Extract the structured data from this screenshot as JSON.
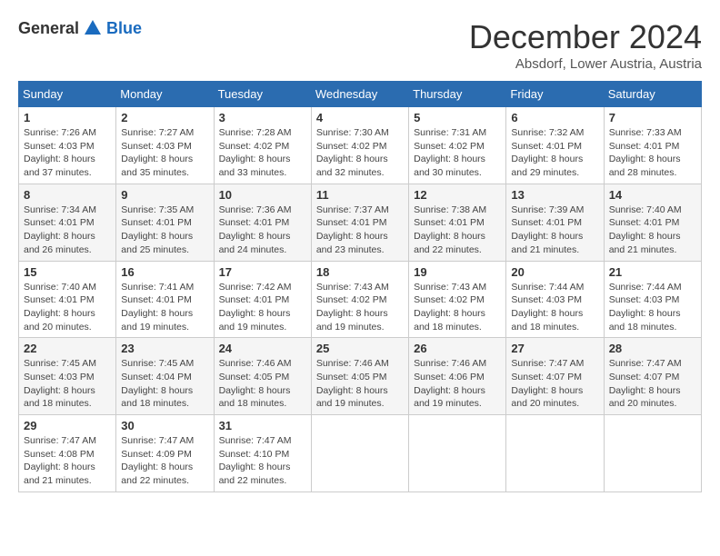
{
  "header": {
    "logo_general": "General",
    "logo_blue": "Blue",
    "title": "December 2024",
    "location": "Absdorf, Lower Austria, Austria"
  },
  "calendar": {
    "days_of_week": [
      "Sunday",
      "Monday",
      "Tuesday",
      "Wednesday",
      "Thursday",
      "Friday",
      "Saturday"
    ],
    "weeks": [
      [
        null,
        {
          "day": 2,
          "sunrise": "7:27 AM",
          "sunset": "4:03 PM",
          "daylight": "8 hours and 35 minutes."
        },
        {
          "day": 3,
          "sunrise": "7:28 AM",
          "sunset": "4:02 PM",
          "daylight": "8 hours and 33 minutes."
        },
        {
          "day": 4,
          "sunrise": "7:30 AM",
          "sunset": "4:02 PM",
          "daylight": "8 hours and 32 minutes."
        },
        {
          "day": 5,
          "sunrise": "7:31 AM",
          "sunset": "4:02 PM",
          "daylight": "8 hours and 30 minutes."
        },
        {
          "day": 6,
          "sunrise": "7:32 AM",
          "sunset": "4:01 PM",
          "daylight": "8 hours and 29 minutes."
        },
        {
          "day": 7,
          "sunrise": "7:33 AM",
          "sunset": "4:01 PM",
          "daylight": "8 hours and 28 minutes."
        }
      ],
      [
        {
          "day": 1,
          "sunrise": "7:26 AM",
          "sunset": "4:03 PM",
          "daylight": "8 hours and 37 minutes."
        },
        null,
        null,
        null,
        null,
        null,
        null
      ],
      [
        {
          "day": 8,
          "sunrise": "7:34 AM",
          "sunset": "4:01 PM",
          "daylight": "8 hours and 26 minutes."
        },
        {
          "day": 9,
          "sunrise": "7:35 AM",
          "sunset": "4:01 PM",
          "daylight": "8 hours and 25 minutes."
        },
        {
          "day": 10,
          "sunrise": "7:36 AM",
          "sunset": "4:01 PM",
          "daylight": "8 hours and 24 minutes."
        },
        {
          "day": 11,
          "sunrise": "7:37 AM",
          "sunset": "4:01 PM",
          "daylight": "8 hours and 23 minutes."
        },
        {
          "day": 12,
          "sunrise": "7:38 AM",
          "sunset": "4:01 PM",
          "daylight": "8 hours and 22 minutes."
        },
        {
          "day": 13,
          "sunrise": "7:39 AM",
          "sunset": "4:01 PM",
          "daylight": "8 hours and 21 minutes."
        },
        {
          "day": 14,
          "sunrise": "7:40 AM",
          "sunset": "4:01 PM",
          "daylight": "8 hours and 21 minutes."
        }
      ],
      [
        {
          "day": 15,
          "sunrise": "7:40 AM",
          "sunset": "4:01 PM",
          "daylight": "8 hours and 20 minutes."
        },
        {
          "day": 16,
          "sunrise": "7:41 AM",
          "sunset": "4:01 PM",
          "daylight": "8 hours and 19 minutes."
        },
        {
          "day": 17,
          "sunrise": "7:42 AM",
          "sunset": "4:01 PM",
          "daylight": "8 hours and 19 minutes."
        },
        {
          "day": 18,
          "sunrise": "7:43 AM",
          "sunset": "4:02 PM",
          "daylight": "8 hours and 19 minutes."
        },
        {
          "day": 19,
          "sunrise": "7:43 AM",
          "sunset": "4:02 PM",
          "daylight": "8 hours and 18 minutes."
        },
        {
          "day": 20,
          "sunrise": "7:44 AM",
          "sunset": "4:03 PM",
          "daylight": "8 hours and 18 minutes."
        },
        {
          "day": 21,
          "sunrise": "7:44 AM",
          "sunset": "4:03 PM",
          "daylight": "8 hours and 18 minutes."
        }
      ],
      [
        {
          "day": 22,
          "sunrise": "7:45 AM",
          "sunset": "4:03 PM",
          "daylight": "8 hours and 18 minutes."
        },
        {
          "day": 23,
          "sunrise": "7:45 AM",
          "sunset": "4:04 PM",
          "daylight": "8 hours and 18 minutes."
        },
        {
          "day": 24,
          "sunrise": "7:46 AM",
          "sunset": "4:05 PM",
          "daylight": "8 hours and 18 minutes."
        },
        {
          "day": 25,
          "sunrise": "7:46 AM",
          "sunset": "4:05 PM",
          "daylight": "8 hours and 19 minutes."
        },
        {
          "day": 26,
          "sunrise": "7:46 AM",
          "sunset": "4:06 PM",
          "daylight": "8 hours and 19 minutes."
        },
        {
          "day": 27,
          "sunrise": "7:47 AM",
          "sunset": "4:07 PM",
          "daylight": "8 hours and 20 minutes."
        },
        {
          "day": 28,
          "sunrise": "7:47 AM",
          "sunset": "4:07 PM",
          "daylight": "8 hours and 20 minutes."
        }
      ],
      [
        {
          "day": 29,
          "sunrise": "7:47 AM",
          "sunset": "4:08 PM",
          "daylight": "8 hours and 21 minutes."
        },
        {
          "day": 30,
          "sunrise": "7:47 AM",
          "sunset": "4:09 PM",
          "daylight": "8 hours and 22 minutes."
        },
        {
          "day": 31,
          "sunrise": "7:47 AM",
          "sunset": "4:10 PM",
          "daylight": "8 hours and 22 minutes."
        },
        null,
        null,
        null,
        null
      ]
    ],
    "labels": {
      "sunrise": "Sunrise:",
      "sunset": "Sunset:",
      "daylight": "Daylight:"
    }
  }
}
